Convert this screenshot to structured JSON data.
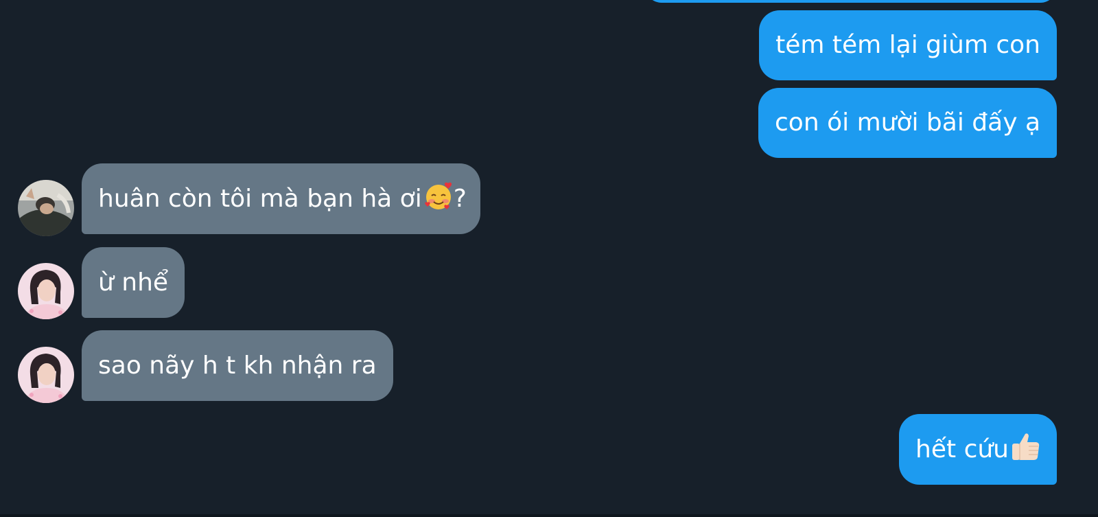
{
  "messages": [
    {
      "id": "m0",
      "side": "sent",
      "text": ""
    },
    {
      "id": "m1",
      "side": "sent",
      "text": "tém tém lại giùm con"
    },
    {
      "id": "m2",
      "side": "sent",
      "text": "con ói mười bãi đấy ạ"
    },
    {
      "id": "m3",
      "side": "received",
      "text": "huân còn tôi mà bạn hà ơi",
      "suffix": "?",
      "emoji": "smiling-face-with-hearts"
    },
    {
      "id": "m4",
      "side": "received",
      "text": "ừ nhể"
    },
    {
      "id": "m5",
      "side": "received",
      "text": "sao nãy h t kh nhận ra"
    },
    {
      "id": "m6",
      "side": "sent",
      "text": "hết cứu",
      "emoji": "thumbs-up"
    }
  ],
  "colors": {
    "background": "#17202a",
    "sent_bubble": "#1d9bf0",
    "received_bubble": "#657786",
    "text": "#ffffff"
  }
}
